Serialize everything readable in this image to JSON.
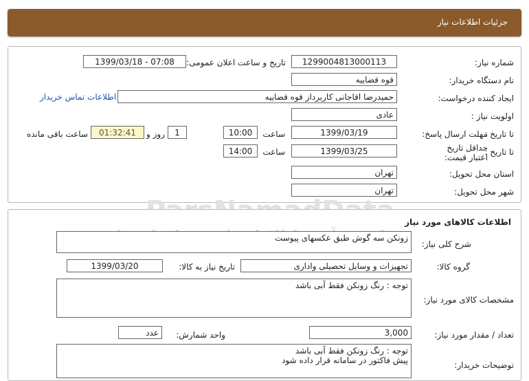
{
  "header": {
    "title": "جزئیات اطلاعات نیاز"
  },
  "watermark": {
    "brand": "ParsNamadData",
    "persian": "مرکز فن آوری اطلاعات پارس نماد داده ها",
    "phone": "۰۲۱-۸۸۳۴۹۶۷۰-۵"
  },
  "info": {
    "need_number_label": "شماره نیاز:",
    "need_number": "1299004813000113",
    "announce_label": "تاریخ و ساعت اعلان عمومی:",
    "announce_value": "1399/03/18 - 07:08",
    "buyer_org_label": "نام دستگاه خریدار:",
    "buyer_org": "قوه قضاییه",
    "requester_label": "ایجاد کننده درخواست:",
    "requester": "حمیدرضا اقاجانی کاربرداز قوه قضاییه",
    "contact_link": "اطلاعات تماس خریدار",
    "priority_label": "اولویت نیاز :",
    "priority": "عادی",
    "send_deadline_label": "مهلت ارسال پاسخ:",
    "to_date_label": "تا تاریخ :",
    "send_date": "1399/03/19",
    "time_label": "ساعت",
    "send_time": "10:00",
    "days": "1",
    "day_and_label": "روز و",
    "remaining_time": "01:32:41",
    "remaining_label": "ساعت باقی مانده",
    "validity_label": "حداقل تاریخ اعتبار قیمت:",
    "validity_to_label": "تا تاریخ :",
    "validity_date": "1399/03/25",
    "validity_time_label": "ساعت",
    "validity_time": "14:00",
    "province_label": "استان محل تحویل:",
    "province": "تهران",
    "city_label": "شهر محل تحویل:",
    "city": "تهران"
  },
  "goods": {
    "section_title": "اطلاعات کالاهای مورد نیاز",
    "summary_label": "شرح کلی نیاز:",
    "summary": "زونکن سه گوش طبق عکسهای پیوست",
    "group_label": "گروه کالا:",
    "group": "تجهیزات و وسایل تحصیلی واداری",
    "need_date_label": "تاریخ نیاز به کالا:",
    "need_date": "1399/03/20",
    "specs_label": "مشخصات کالای مورد نیاز:",
    "specs": "توجه : رنگ زونکن فقط آبی باشد",
    "qty_label": "تعداد / مقدار مورد نیاز:",
    "qty": "3,000",
    "unit_label": "واحد شمارش:",
    "unit": "عدد",
    "buyer_notes_label": "توضیحات خریدار:",
    "buyer_notes_line1": "توجه : رنگ زونکن فقط آبی باشد",
    "buyer_notes_line2": "پیش فاکتور در سامانه قرار داده شود"
  }
}
